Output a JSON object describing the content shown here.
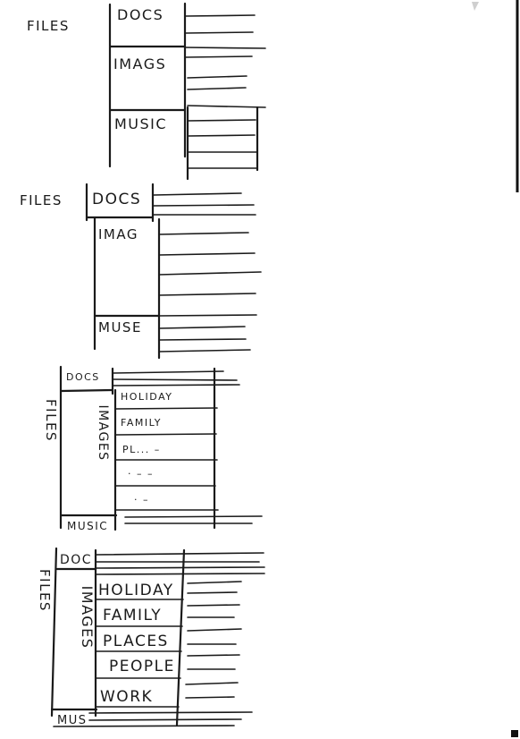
{
  "sketch_1": {
    "root": "FILES",
    "cat_a": "DOCS",
    "cat_b": "IMAGS",
    "cat_c": "MUSIC"
  },
  "sketch_2": {
    "root": "FILES",
    "cat_a": "DOCS",
    "cat_b": "IMAG",
    "cat_c": "MUSE"
  },
  "sketch_3": {
    "root": "FILES",
    "cat_a": "DOCS",
    "cat_b": "IMAGES",
    "cat_c": "MUSIC",
    "sub_1": "HOLIDAY",
    "sub_2": "FAMILY",
    "sub_3": "PL... –",
    "sub_4": "· – –",
    "sub_5": "· –"
  },
  "sketch_4": {
    "root": "FILES",
    "cat_a": "DOC",
    "cat_b": "IMAGES",
    "cat_c": "MUS",
    "sub_1": "HOLIDAY",
    "sub_2": "FAMILY",
    "sub_3": "PLACES",
    "sub_4": "PEOPLE",
    "sub_5": "WORK"
  },
  "colors": {
    "ink": "#1a1a1a",
    "paper": "#ffffff"
  }
}
